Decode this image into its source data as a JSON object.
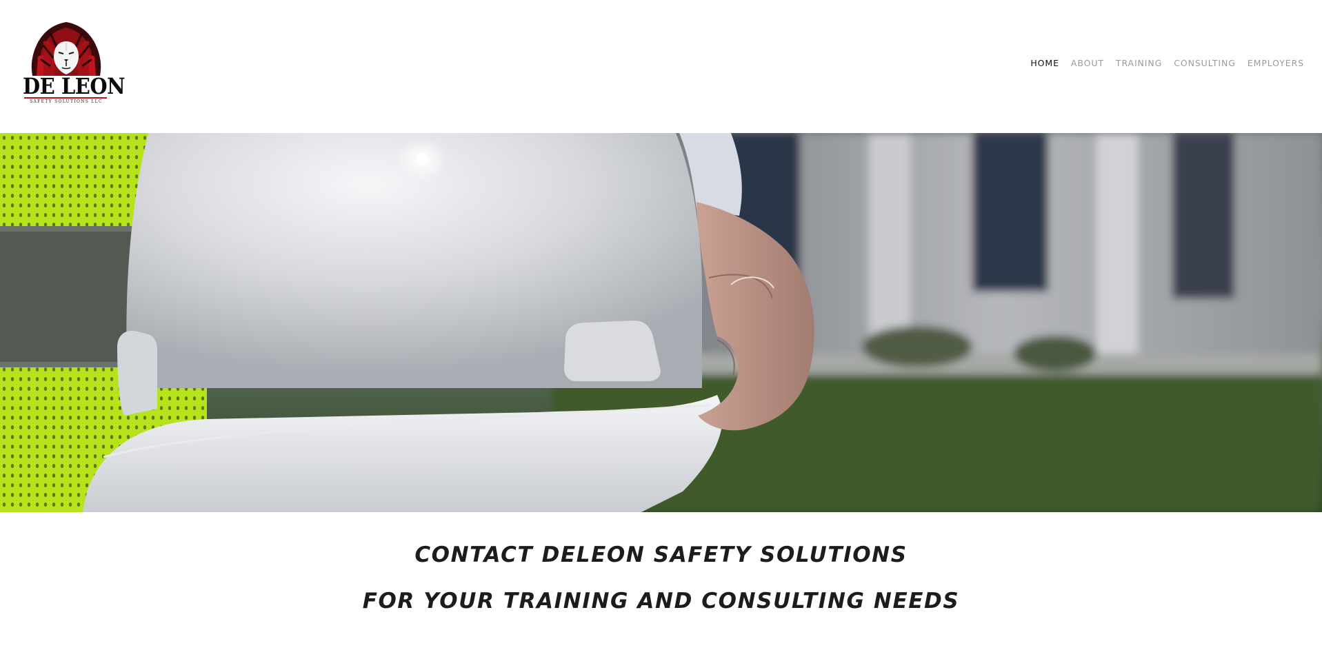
{
  "header": {
    "logo": {
      "name": "DE LEON",
      "tagline": "SAFETY SOLUTIONS LLC"
    },
    "nav": [
      {
        "label": "HOME",
        "active": true
      },
      {
        "label": "ABOUT",
        "active": false
      },
      {
        "label": "TRAINING",
        "active": false
      },
      {
        "label": "CONSULTING",
        "active": false
      },
      {
        "label": "EMPLOYERS",
        "active": false
      }
    ]
  },
  "tagline": {
    "line1": "CONTACT DELEON SAFETY SOLUTIONS",
    "line2": "FOR YOUR TRAINING AND CONSULTING NEEDS"
  },
  "colors": {
    "brand_red": "#b3141b",
    "nav_active": "#111111",
    "nav_inactive": "#9a9a9a",
    "tagline_text": "#1c1c1c",
    "safety_vest": "#b9e81f",
    "hard_hat": "#e8e9ec"
  }
}
